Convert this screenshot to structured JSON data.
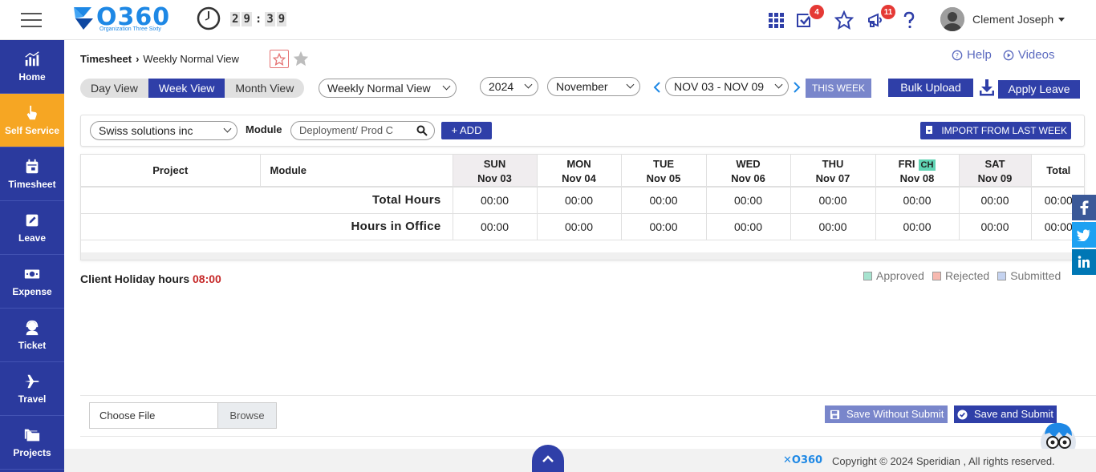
{
  "header": {
    "logo_text": "O360",
    "logo_sub": "Organization Three Sixty",
    "timer": [
      "2",
      "9",
      "3",
      "9"
    ],
    "tasks_badge": "4",
    "announcements_badge": "11",
    "user_name": "Clement Joseph"
  },
  "sidebar": {
    "items": [
      {
        "label": "Home",
        "icon": "chart-icon"
      },
      {
        "label": "Self Service",
        "icon": "hand-pointer-icon",
        "active": true
      },
      {
        "label": "Timesheet",
        "icon": "calendar-icon"
      },
      {
        "label": "Leave",
        "icon": "edit-icon"
      },
      {
        "label": "Expense",
        "icon": "money-icon"
      },
      {
        "label": "Ticket",
        "icon": "headset-icon"
      },
      {
        "label": "Travel",
        "icon": "plane-icon"
      },
      {
        "label": "Projects",
        "icon": "folders-icon"
      }
    ]
  },
  "breadcrumb": {
    "parent": "Timesheet",
    "current": "Weekly Normal View"
  },
  "help": {
    "help_label": "Help",
    "videos_label": "Videos"
  },
  "views": {
    "day": "Day View",
    "week": "Week View",
    "month": "Month View"
  },
  "view_select": "Weekly Normal View",
  "year_select": "2024",
  "month_select": "November",
  "week_range": "NOV 03 - NOV 09",
  "this_week": "THIS WEEK",
  "bulk_upload": "Bulk Upload",
  "apply_leave": "Apply Leave",
  "filters": {
    "client": "Swiss solutions inc",
    "module_label": "Module",
    "module_value": "Deployment/ Prod C",
    "add_label": "ADD",
    "import_label": "IMPORT FROM LAST WEEK"
  },
  "table": {
    "project_header": "Project",
    "module_header": "Module",
    "days": [
      {
        "name": "SUN",
        "date": "Nov 03"
      },
      {
        "name": "MON",
        "date": "Nov 04"
      },
      {
        "name": "TUE",
        "date": "Nov 05"
      },
      {
        "name": "WED",
        "date": "Nov 06"
      },
      {
        "name": "THU",
        "date": "Nov 07"
      },
      {
        "name": "FRI",
        "date": "Nov 08",
        "tag": "CH"
      },
      {
        "name": "SAT",
        "date": "Nov 09"
      }
    ],
    "total_header": "Total",
    "rows": [
      {
        "label": "Total Hours",
        "values": [
          "00:00",
          "00:00",
          "00:00",
          "00:00",
          "00:00",
          "00:00",
          "00:00",
          "00:00"
        ]
      },
      {
        "label": "Hours in Office",
        "values": [
          "00:00",
          "00:00",
          "00:00",
          "00:00",
          "00:00",
          "00:00",
          "00:00",
          "00:00"
        ]
      }
    ]
  },
  "holiday": {
    "label": "Client Holiday hours",
    "value": "08:00"
  },
  "legend": [
    {
      "label": "Approved",
      "color": "#a6e3cf"
    },
    {
      "label": "Rejected",
      "color": "#f7b9b0"
    },
    {
      "label": "Submitted",
      "color": "#c5d3f0"
    }
  ],
  "file": {
    "choose": "Choose File",
    "browse": "Browse"
  },
  "save_without_submit": "Save Without Submit",
  "save_and_submit": "Save and Submit",
  "footer": {
    "logo": "O360",
    "copyright": "Copyright © 2024 Speridian , All rights reserved."
  },
  "colors": {
    "primary": "#2f3fa8",
    "accent": "#f6a623",
    "brand": "#1e88e5"
  }
}
